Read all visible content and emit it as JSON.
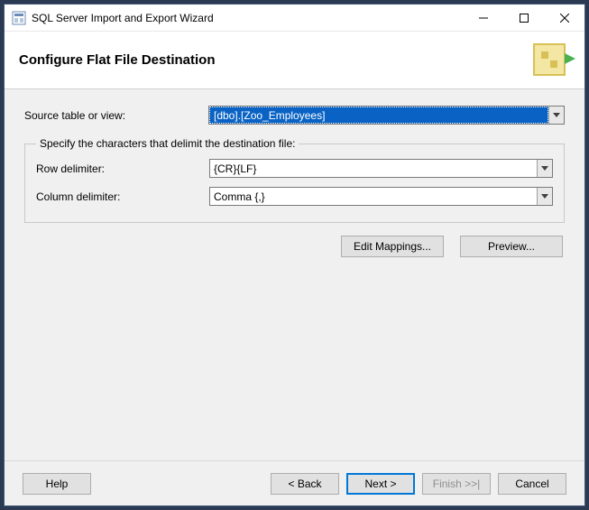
{
  "window": {
    "title": "SQL Server Import and Export Wizard"
  },
  "header": {
    "title": "Configure Flat File Destination"
  },
  "source": {
    "label": "Source table or view:",
    "value": "[dbo].[Zoo_Employees]"
  },
  "delimiters": {
    "legend": "Specify the characters that delimit the destination file:",
    "row": {
      "label": "Row delimiter:",
      "value": "{CR}{LF}"
    },
    "column": {
      "label": "Column delimiter:",
      "value": "Comma {,}"
    }
  },
  "actions": {
    "edit_mappings": "Edit Mappings...",
    "preview": "Preview..."
  },
  "footer": {
    "help": "Help",
    "back": "< Back",
    "next": "Next >",
    "finish": "Finish >>|",
    "cancel": "Cancel"
  }
}
